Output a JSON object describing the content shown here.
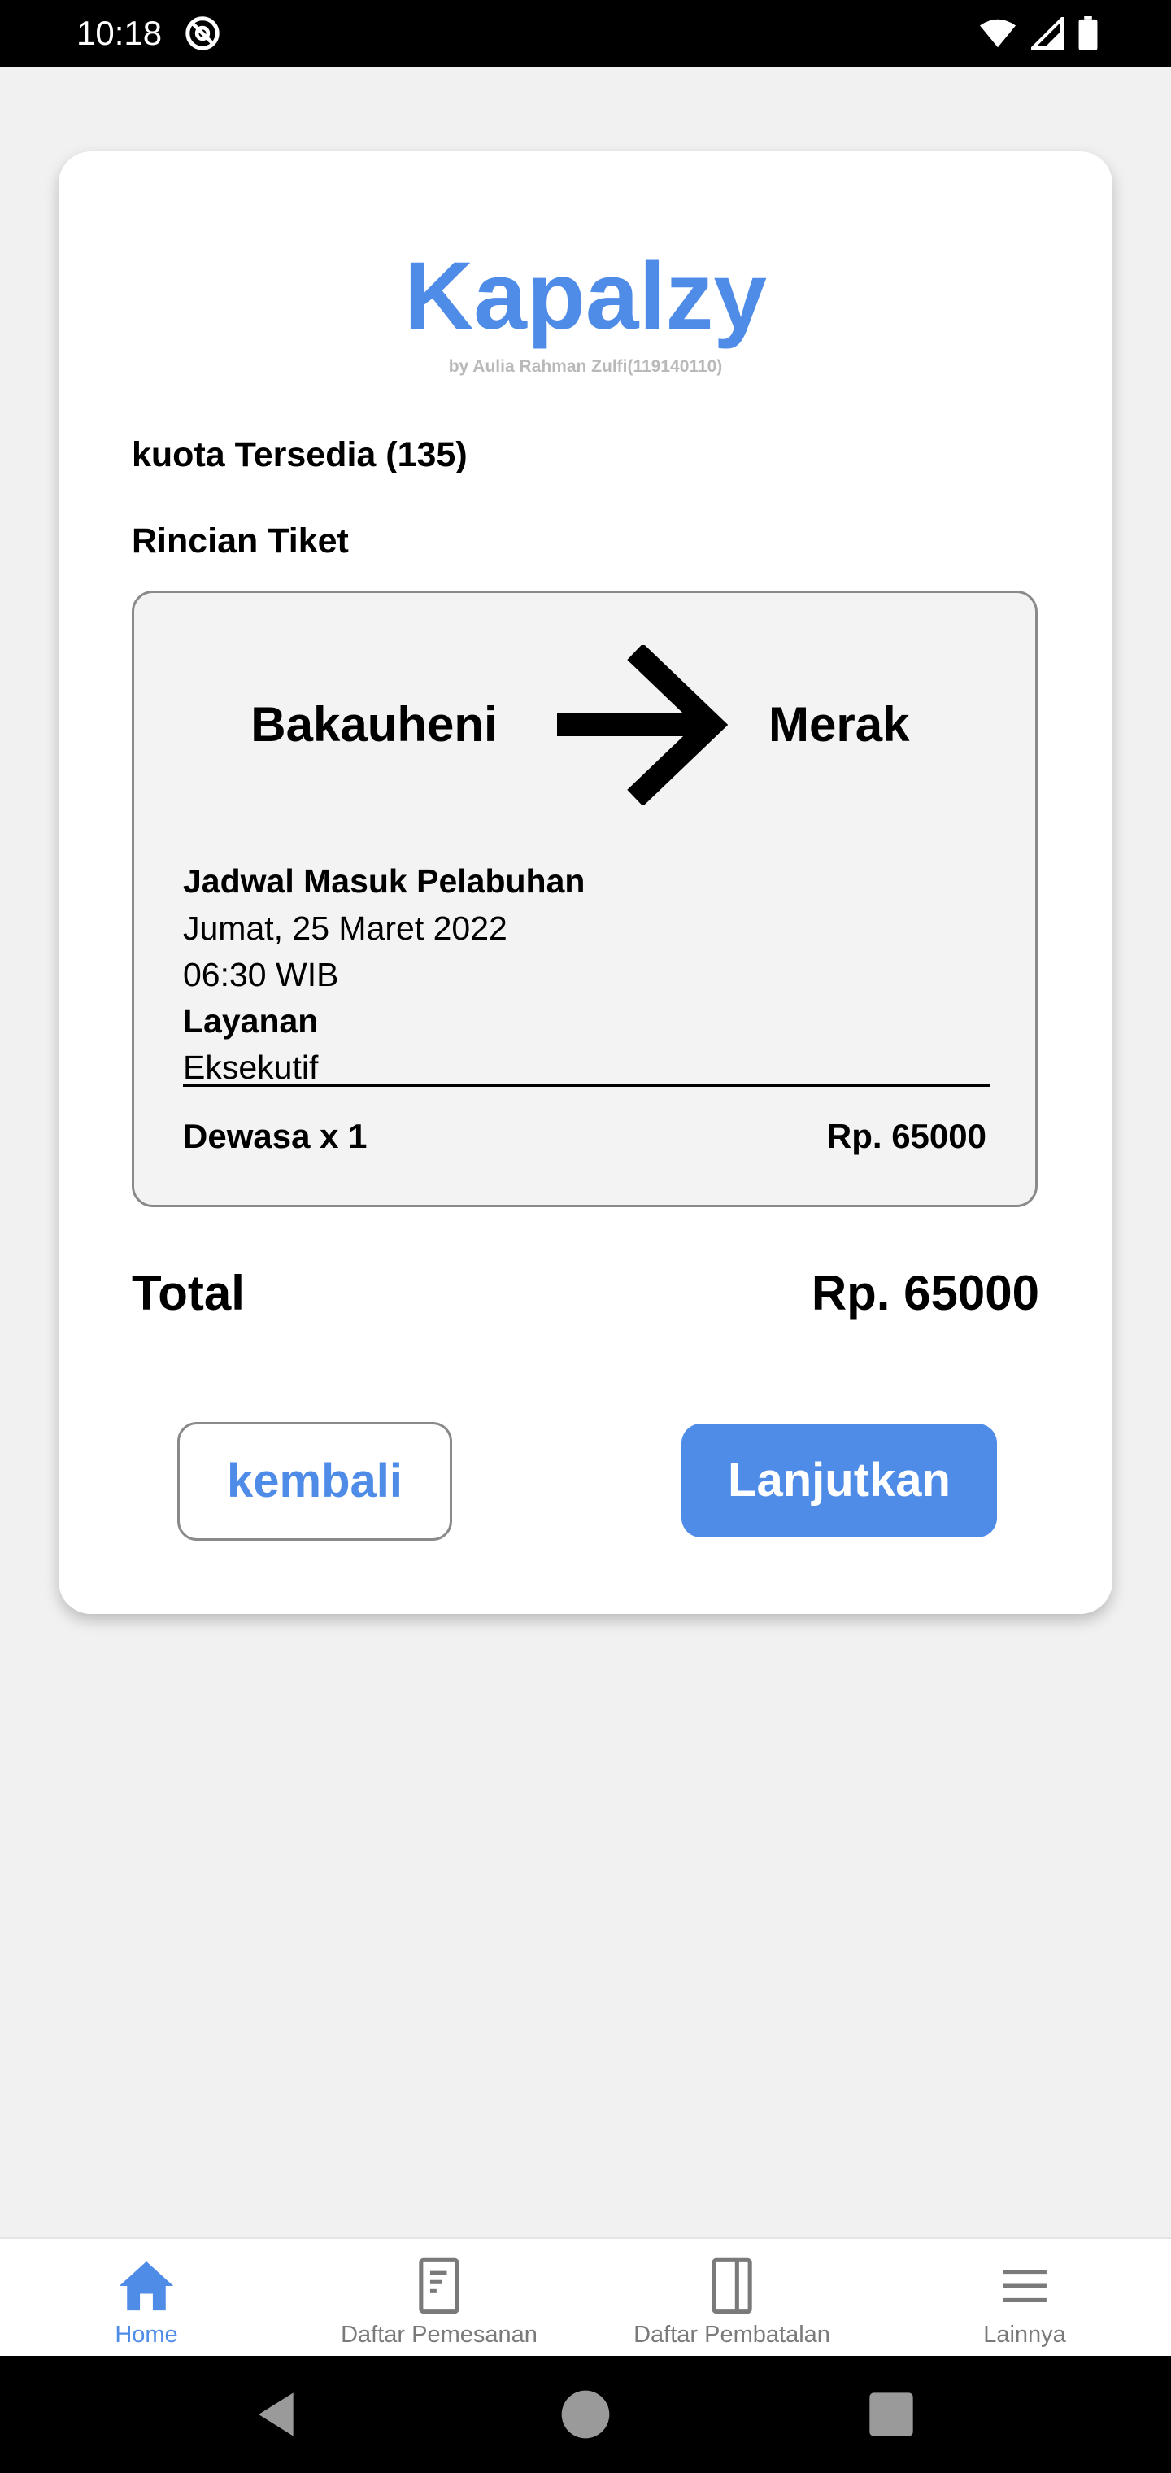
{
  "status_bar": {
    "time": "10:18"
  },
  "brand": {
    "title": "Kapalzy",
    "subtitle": "by Aulia Rahman Zulfi(119140110)"
  },
  "quota_text": "kuota Tersedia (135)",
  "ticket_section_title": "Rincian Tiket",
  "ticket": {
    "from": "Bakauheni",
    "to": "Merak",
    "schedule_label": "Jadwal Masuk Pelabuhan",
    "date": "Jumat, 25 Maret 2022",
    "time": "06:30 WIB",
    "service_label": "Layanan",
    "service_value": "Eksekutif",
    "passenger": "Dewasa x 1",
    "price": "Rp. 65000"
  },
  "total": {
    "label": "Total",
    "value": "Rp. 65000"
  },
  "buttons": {
    "back": "kembali",
    "next": "Lanjutkan"
  },
  "bottom_nav": {
    "items": [
      {
        "label": "Home",
        "icon": "home-icon",
        "active": true
      },
      {
        "label": "Daftar Pemesanan",
        "icon": "document-icon",
        "active": false
      },
      {
        "label": "Daftar Pembatalan",
        "icon": "book-icon",
        "active": false
      },
      {
        "label": "Lainnya",
        "icon": "menu-icon",
        "active": false
      }
    ]
  },
  "colors": {
    "accent": "#4f8ce8",
    "muted": "#7a7a7a",
    "background": "#f1f1f1"
  }
}
